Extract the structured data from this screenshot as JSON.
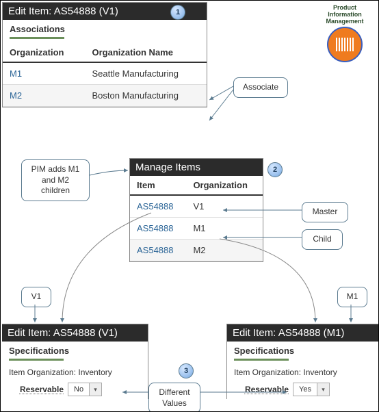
{
  "pim_badge": {
    "line1": "Product",
    "line2": "Information",
    "line3": "Management"
  },
  "step1": "1",
  "step2": "2",
  "step3": "3",
  "panel1": {
    "title": "Edit Item: AS54888 (V1)",
    "subhead": "Associations",
    "cols": {
      "org": "Organization",
      "name": "Organization Name"
    },
    "rows": [
      {
        "org": "M1",
        "name": "Seattle Manufacturing"
      },
      {
        "org": "M2",
        "name": "Boston Manufacturing"
      }
    ]
  },
  "callouts": {
    "associate": "Associate",
    "pim_adds": "PIM adds M1\nand M2\nchildren",
    "master": "Master",
    "child": "Child",
    "v1": "V1",
    "m1": "M1",
    "diff": "Different\nValues"
  },
  "panel2": {
    "title": "Manage Items",
    "cols": {
      "item": "Item",
      "org": "Organization"
    },
    "rows": [
      {
        "item": "AS54888",
        "org": "V1"
      },
      {
        "item": "AS54888",
        "org": "M1"
      },
      {
        "item": "AS54888",
        "org": "M2"
      }
    ]
  },
  "panel3": {
    "title": "Edit Item: AS54888 (V1)",
    "subhead": "Specifications",
    "orgline": "Item Organization: Inventory",
    "reservable_label": "Reservable",
    "reservable_value": "No"
  },
  "panel4": {
    "title": "Edit Item: AS54888 (M1)",
    "subhead": "Specifications",
    "orgline": "Item Organization: Inventory",
    "reservable_label": "Reservable",
    "reservable_value": "Yes"
  }
}
